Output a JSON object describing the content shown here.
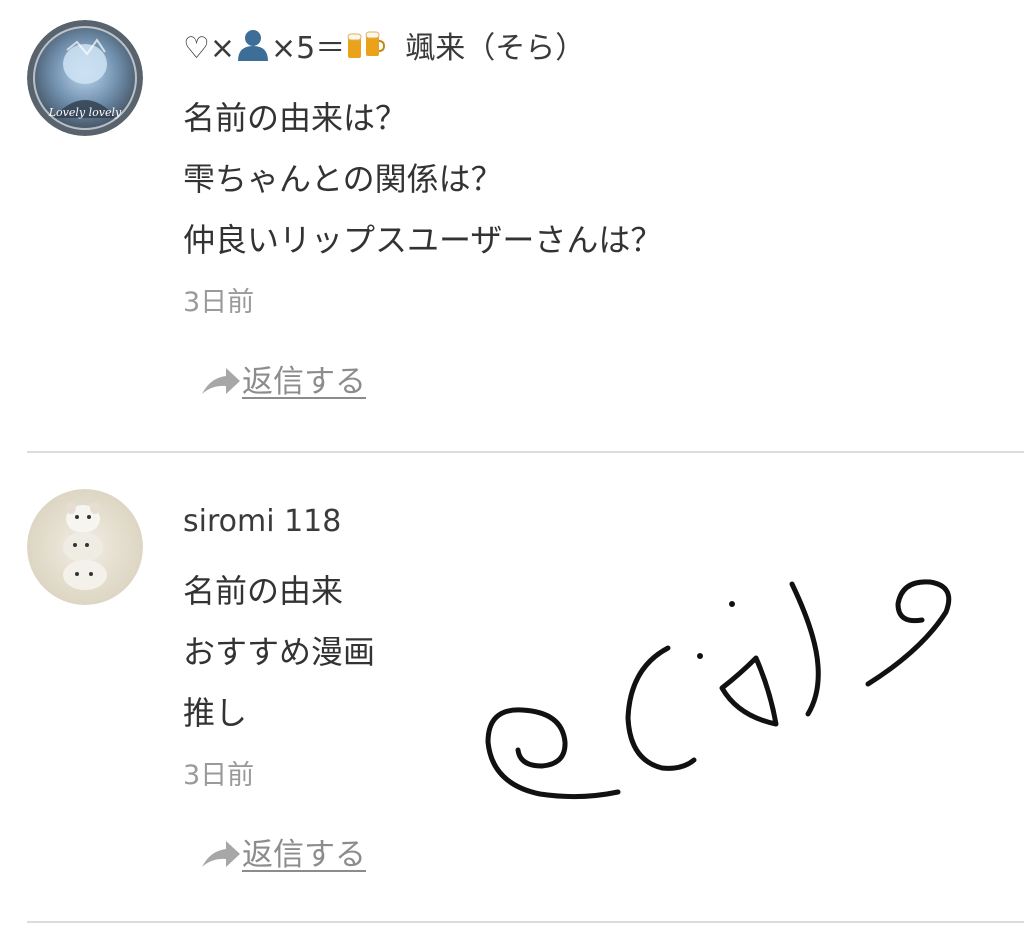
{
  "comments": [
    {
      "username_prefix": "♡×",
      "username_mid": "×5＝",
      "username_name": "颯来（そら）",
      "username_icons": [
        "person-silhouette-icon",
        "beer-mugs-icon"
      ],
      "lines": [
        "名前の由来は？",
        "雫ちゃんとの関係は？",
        "仲良いリップスユーザーさんは？"
      ],
      "timestamp": "3日前",
      "reply_label": "返信する",
      "avatar_text": "Lovely lovely"
    },
    {
      "username": "siromi 118",
      "lines": [
        "名前の由来",
        "おすすめ漫画",
        "推し"
      ],
      "timestamp": "3日前",
      "reply_label": "返信する"
    }
  ],
  "colors": {
    "text": "#333333",
    "timestamp": "#9a9a9a",
    "reply": "#8c8c8c",
    "divider": "#dcdcdc",
    "avatar1_ring": "#5a6470",
    "avatar2_bg": "#e8e2d4"
  }
}
